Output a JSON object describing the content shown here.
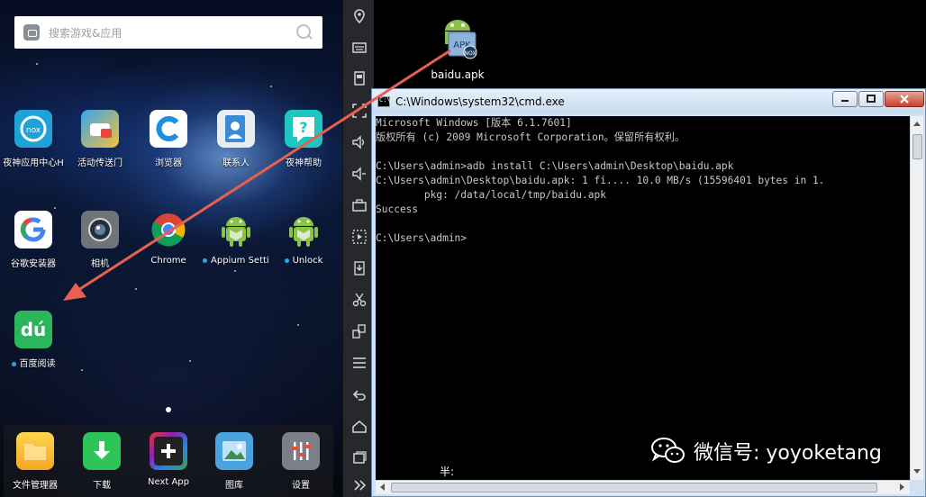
{
  "emulator": {
    "search_placeholder": "搜索游戏&应用",
    "apps": [
      {
        "label": "夜神应用中心H",
        "icon": "nox-app-center-icon",
        "dot": false
      },
      {
        "label": "活动传送门",
        "icon": "event-portal-icon",
        "dot": false
      },
      {
        "label": "浏览器",
        "icon": "browser-icon",
        "dot": false
      },
      {
        "label": "联系人",
        "icon": "contacts-icon",
        "dot": false
      },
      {
        "label": "夜神帮助",
        "icon": "nox-help-icon",
        "dot": false
      },
      {
        "label": "谷歌安装器",
        "icon": "google-installer-icon",
        "dot": false
      },
      {
        "label": "相机",
        "icon": "camera-icon",
        "dot": false
      },
      {
        "label": "Chrome",
        "icon": "chrome-icon",
        "dot": false
      },
      {
        "label": "Appium Setting",
        "icon": "android-icon",
        "dot": true
      },
      {
        "label": "Unlock",
        "icon": "android-icon",
        "dot": true
      },
      {
        "label": "百度阅读",
        "icon": "baidu-reader-icon",
        "dot": true
      }
    ],
    "dock": [
      {
        "label": "文件管理器",
        "icon": "file-manager-icon"
      },
      {
        "label": "下载",
        "icon": "download-icon"
      },
      {
        "label": "Next App",
        "icon": "next-app-icon"
      },
      {
        "label": "图库",
        "icon": "gallery-icon"
      },
      {
        "label": "设置",
        "icon": "settings-icon"
      }
    ],
    "baidu_icon_text": "dú"
  },
  "desktop": {
    "apk_file_label": "baidu.apk",
    "apk_badge": "APK",
    "apk_sub_badge": "NOX"
  },
  "cmd": {
    "title": "C:\\Windows\\system32\\cmd.exe",
    "lines": [
      "Microsoft Windows [版本 6.1.7601]",
      "版权所有 (c) 2009 Microsoft Corporation。保留所有权利。",
      "",
      "C:\\Users\\admin>adb install C:\\Users\\admin\\Desktop\\baidu.apk",
      "C:\\Users\\admin\\Desktop\\baidu.apk: 1 fi.... 10.0 MB/s (15596401 bytes in 1.",
      "        pkg: /data/local/tmp/baidu.apk",
      "Success",
      "",
      "C:\\Users\\admin>"
    ],
    "ime_text": "半:"
  },
  "watermark": {
    "text": "微信号: yoyoketang"
  },
  "colors": {
    "arrow": "#e8604f",
    "cmd_text": "#c8c8c8",
    "dot": "#27a9e1"
  }
}
